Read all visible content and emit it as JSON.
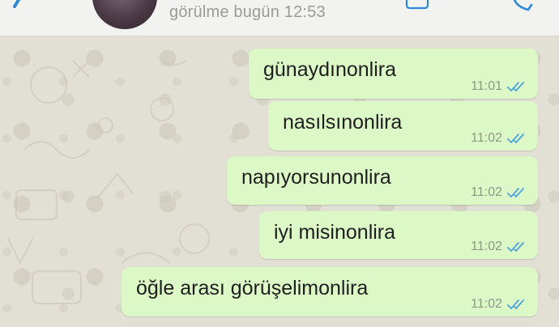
{
  "header": {
    "status_text": "görülme bugün 12:53"
  },
  "colors": {
    "bubble_outgoing": "#dcf8c6",
    "read_ticks": "#4fa3dc",
    "chat_background": "#e2dfd4"
  },
  "icons": {
    "back": "back-chevron-icon",
    "video": "video-call-icon",
    "call": "phone-call-icon",
    "read_receipt": "double-check-icon"
  },
  "messages": [
    {
      "text": "günaydınonlira",
      "time": "11:01",
      "status": "read"
    },
    {
      "text": "nasılsınonlira",
      "time": "11:02",
      "status": "read"
    },
    {
      "text": "napıyorsunonlira",
      "time": "11:02",
      "status": "read"
    },
    {
      "text": "iyi misinonlira",
      "time": "11:02",
      "status": "read"
    },
    {
      "text": "öğle arası görüşelimonlira",
      "time": "11:02",
      "status": "read"
    }
  ]
}
